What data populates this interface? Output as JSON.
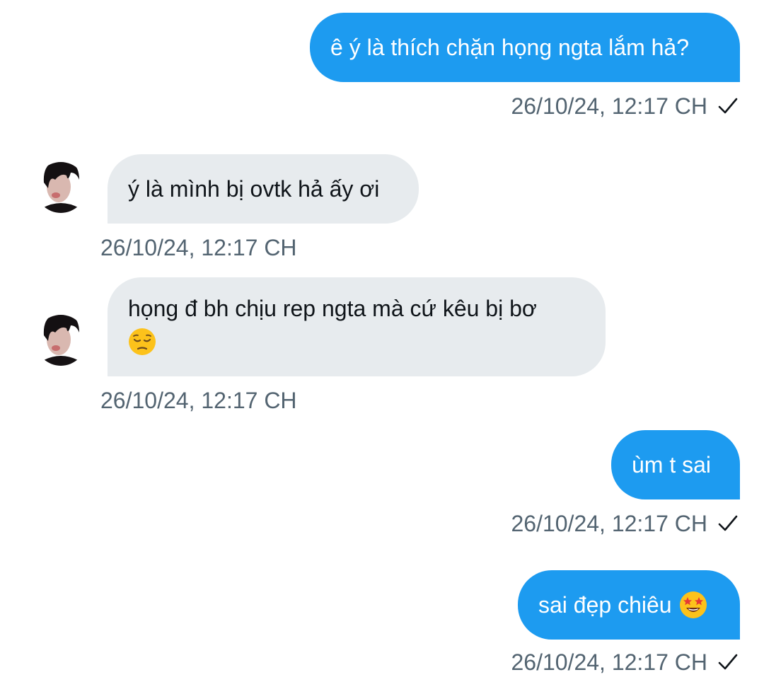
{
  "messages": [
    {
      "text": "ê ý là thích chặn họng ngta lắm hả?",
      "time": "26/10/24, 12:17 CH"
    },
    {
      "text": "ý là mình bị ovtk hả ấy ơi",
      "time": "26/10/24, 12:17 CH"
    },
    {
      "text": "họng đ bh chịu rep ngta mà cứ kêu bị bơ",
      "emoji": "pensive-face-emoji",
      "time": "26/10/24, 12:17 CH"
    },
    {
      "text": "ùm t sai",
      "time": "26/10/24, 12:17 CH"
    },
    {
      "text": "sai đẹp chiêu",
      "emoji": "star-struck-emoji",
      "time": "26/10/24, 12:17 CH"
    }
  ],
  "colors": {
    "outgoing_bubble": "#1d9bf0",
    "incoming_bubble": "#e7ebee",
    "timestamp": "#536471"
  },
  "icons": {
    "read_receipt": "check-icon",
    "avatar": "avatar"
  }
}
